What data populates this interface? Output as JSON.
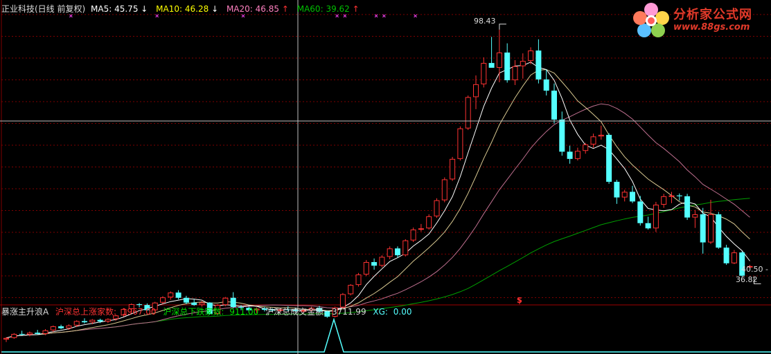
{
  "main_panel": {
    "title": "正业科技(日线 前复权)",
    "ma5": {
      "label": "MA5:",
      "value": "45.75",
      "arrow": "↓",
      "color": "#ffffff"
    },
    "ma10": {
      "label": "MA10:",
      "value": "46.28",
      "arrow": "↓",
      "color": "#ffff00"
    },
    "ma20": {
      "label": "MA20:",
      "value": "46.85",
      "arrow": "↑",
      "color": "#ff80c0"
    },
    "ma60": {
      "label": "MA60:",
      "value": "39.62",
      "arrow": "↑",
      "color": "#00c000"
    },
    "high_label": "98.43",
    "low_label": "36.82",
    "current_label": "40.50 -",
    "signal_marker": "S"
  },
  "indicator_panel": {
    "name": "暴涨主升浪A",
    "up_label": "沪深总上涨家数:",
    "up_value": "1967.00",
    "down_label": "沪深总下跌家数:",
    "down_value": "911.00",
    "amount_label": "沪深总成交金额:",
    "amount_value": "3711.99",
    "xg_label": "XG:",
    "xg_value": "0.00"
  },
  "logo": {
    "title": "分析家公式网",
    "url": "www.88gs.com"
  },
  "colors": {
    "up": "#ff3232",
    "down": "#54ffff",
    "grid": "#800000",
    "crosshair": "#c0c0c0"
  },
  "chart_data": {
    "type": "candlestick",
    "ylim": [
      30,
      102
    ],
    "candles": [
      [
        21.2,
        21.8,
        20.6,
        21.6
      ],
      [
        21.6,
        22.8,
        21.4,
        22.6
      ],
      [
        22.6,
        23.4,
        22.2,
        22.4
      ],
      [
        22.4,
        23.2,
        22.0,
        22.9
      ],
      [
        22.9,
        23.6,
        22.5,
        22.6
      ],
      [
        22.6,
        23.8,
        22.3,
        23.5
      ],
      [
        23.5,
        24.7,
        23.1,
        24.5
      ],
      [
        24.5,
        24.9,
        23.8,
        24.0
      ],
      [
        24.0,
        25.0,
        23.6,
        24.7
      ],
      [
        24.7,
        26.0,
        24.3,
        25.8
      ],
      [
        25.8,
        26.5,
        25.2,
        25.5
      ],
      [
        25.5,
        26.3,
        25.0,
        26.1
      ],
      [
        26.1,
        26.4,
        25.3,
        25.7
      ],
      [
        25.7,
        26.5,
        25.3,
        26.3
      ],
      [
        26.3,
        27.4,
        25.9,
        27.2
      ],
      [
        27.2,
        29.0,
        26.9,
        28.8
      ],
      [
        28.8,
        30.2,
        28.4,
        30.0
      ],
      [
        30.0,
        30.3,
        29.2,
        29.8
      ],
      [
        29.8,
        30.2,
        28.4,
        28.5
      ],
      [
        28.5,
        30.6,
        28.2,
        30.4
      ],
      [
        30.4,
        32.0,
        30.1,
        31.7
      ],
      [
        31.7,
        33.2,
        31.1,
        32.9
      ],
      [
        32.9,
        33.5,
        31.2,
        31.6
      ],
      [
        31.6,
        32.1,
        30.0,
        30.4
      ],
      [
        30.4,
        31.2,
        29.6,
        29.8
      ],
      [
        29.8,
        30.8,
        29.4,
        30.4
      ],
      [
        30.4,
        30.5,
        27.4,
        27.6
      ],
      [
        27.6,
        30.0,
        27.3,
        29.8
      ],
      [
        29.8,
        31.8,
        29.5,
        31.6
      ],
      [
        31.6,
        33.0,
        29.0,
        29.3
      ],
      [
        29.3,
        29.8,
        28.5,
        29.1
      ],
      [
        29.1,
        29.4,
        28.0,
        28.5
      ],
      [
        28.5,
        29.2,
        27.8,
        28.9
      ],
      [
        28.9,
        29.3,
        28.2,
        28.6
      ],
      [
        28.6,
        29.0,
        28.1,
        28.4
      ],
      [
        28.4,
        28.9,
        28.0,
        28.7
      ],
      [
        28.7,
        29.5,
        28.3,
        28.6
      ],
      [
        28.6,
        29.0,
        27.9,
        28.3
      ],
      [
        28.3,
        28.8,
        27.8,
        28.5
      ],
      [
        28.5,
        29.4,
        28.2,
        29.1
      ],
      [
        29.1,
        29.6,
        28.0,
        28.2
      ],
      [
        28.2,
        28.4,
        26.6,
        26.9
      ],
      [
        26.9,
        29.4,
        26.7,
        29.2
      ],
      [
        29.2,
        32.8,
        29.0,
        32.5
      ],
      [
        32.5,
        35.0,
        32.2,
        34.8
      ],
      [
        34.8,
        37.8,
        34.4,
        37.4
      ],
      [
        37.4,
        41.0,
        37.0,
        40.5
      ],
      [
        40.5,
        41.4,
        38.6,
        39.6
      ],
      [
        39.6,
        42.2,
        39.2,
        41.8
      ],
      [
        41.8,
        44.4,
        41.2,
        43.9
      ],
      [
        43.9,
        44.4,
        41.6,
        42.2
      ],
      [
        42.2,
        46.2,
        41.9,
        45.9
      ],
      [
        45.9,
        49.1,
        45.5,
        48.6
      ],
      [
        48.6,
        50.0,
        48.1,
        48.9
      ],
      [
        48.9,
        52.4,
        48.6,
        51.9
      ],
      [
        51.9,
        56.4,
        51.5,
        55.9
      ],
      [
        55.9,
        61.6,
        55.4,
        61.1
      ],
      [
        61.1,
        66.7,
        60.7,
        66.2
      ],
      [
        66.2,
        74.3,
        65.8,
        73.8
      ],
      [
        73.8,
        82.0,
        73.4,
        81.6
      ],
      [
        81.6,
        87.0,
        78.6,
        84.8
      ],
      [
        84.8,
        91.5,
        84.0,
        90.1
      ],
      [
        90.1,
        96.6,
        89.5,
        88.9
      ],
      [
        88.9,
        98.4,
        85.3,
        92.7
      ],
      [
        92.7,
        95.0,
        85.2,
        85.8
      ],
      [
        85.8,
        90.8,
        84.6,
        89.3
      ],
      [
        89.3,
        92.5,
        86.2,
        90.6
      ],
      [
        90.6,
        94.0,
        89.8,
        93.2
      ],
      [
        93.2,
        96.0,
        85.0,
        86.0
      ],
      [
        86.0,
        88.5,
        82.0,
        83.2
      ],
      [
        83.2,
        85.0,
        75.0,
        76.0
      ],
      [
        76.0,
        78.0,
        67.0,
        68.0
      ],
      [
        68.0,
        69.5,
        65.0,
        66.2
      ],
      [
        66.2,
        69.0,
        65.8,
        68.2
      ],
      [
        68.2,
        70.2,
        67.5,
        69.8
      ],
      [
        69.8,
        72.5,
        69.0,
        71.8
      ],
      [
        71.8,
        74.5,
        71.0,
        72.2
      ],
      [
        72.2,
        72.6,
        60.0,
        60.5
      ],
      [
        60.5,
        61.0,
        55.0,
        56.6
      ],
      [
        56.6,
        58.5,
        55.6,
        58.0
      ],
      [
        58.0,
        59.5,
        55.2,
        55.6
      ],
      [
        55.6,
        57.0,
        49.6,
        50.2
      ],
      [
        50.2,
        51.8,
        48.6,
        48.9
      ],
      [
        48.9,
        55.5,
        48.0,
        54.8
      ],
      [
        54.8,
        57.5,
        54.0,
        56.9
      ],
      [
        56.9,
        58.0,
        55.2,
        57.1
      ],
      [
        57.1,
        57.6,
        55.8,
        56.9
      ],
      [
        56.9,
        57.5,
        51.0,
        51.6
      ],
      [
        51.6,
        53.5,
        49.0,
        52.4
      ],
      [
        52.4,
        54.0,
        42.6,
        45.4
      ],
      [
        45.4,
        56.0,
        45.0,
        52.4
      ],
      [
        52.4,
        53.0,
        43.8,
        44.1
      ],
      [
        44.1,
        44.8,
        39.8,
        40.2
      ],
      [
        40.2,
        43.5,
        40.0,
        42.9
      ],
      [
        42.9,
        43.2,
        36.8,
        37.1
      ],
      [
        39.5,
        39.8,
        39.3,
        39.5
      ]
    ]
  }
}
